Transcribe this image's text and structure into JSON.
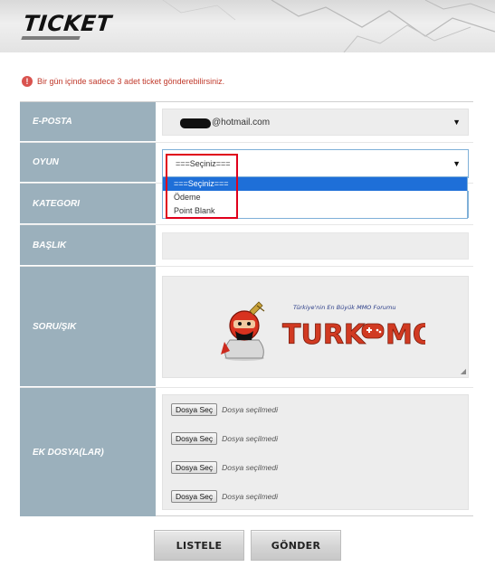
{
  "header": {
    "title": "TICKET"
  },
  "notice": {
    "icon": "exclamation-icon",
    "text": "Bir gün içinde sadece 3 adet ticket gönderebilirsiniz."
  },
  "form": {
    "email": {
      "label": "E-POSTA",
      "value": "@hotmail.com"
    },
    "game": {
      "label": "OYUN",
      "value": "===Seçiniz===",
      "options": [
        "===Seçiniz===",
        "Ödeme",
        "Point Blank"
      ],
      "selected_index": 0
    },
    "category": {
      "label": "KATEGORI"
    },
    "subject": {
      "label": "BAŞLIK",
      "value": ""
    },
    "question": {
      "label": "SORU/ŞIK",
      "logo": {
        "tagline": "Türkiye'nin En Büyük MMO Forumu",
        "brand_left": "TURK",
        "brand_right": "MO"
      }
    },
    "attachments": {
      "label": "EK DOSYA(LAR)",
      "files": [
        {
          "button": "Dosya Seç",
          "status": "Dosya seçilmedi"
        },
        {
          "button": "Dosya Seç",
          "status": "Dosya seçilmedi"
        },
        {
          "button": "Dosya Seç",
          "status": "Dosya seçilmedi"
        },
        {
          "button": "Dosya Seç",
          "status": "Dosya seçilmedi"
        }
      ]
    }
  },
  "actions": {
    "list": "LISTELE",
    "send": "GÖNDER"
  },
  "colors": {
    "label_bg": "#9bb0bc",
    "warning": "#c0392b",
    "highlight": "#e0001b",
    "dropdown_selected": "#1e6fd8"
  }
}
